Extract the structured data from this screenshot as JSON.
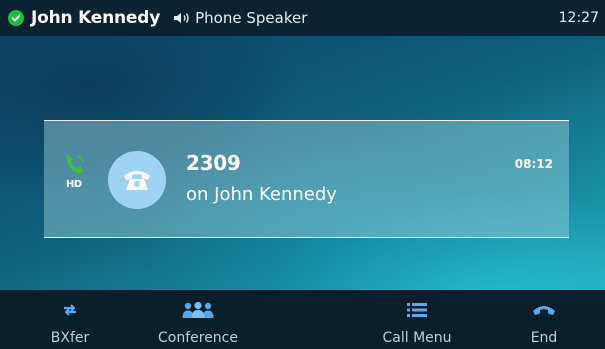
{
  "status_bar": {
    "account_name": "John Kennedy",
    "audio_mode": "Phone Speaker",
    "time": "12:27",
    "status_icon": "registered-check-icon",
    "audio_icon": "speaker-icon"
  },
  "call": {
    "number": "2309",
    "line_label": "on John Kennedy",
    "duration": "08:12",
    "line_icon": "handset-icon",
    "hd_label": "HD",
    "avatar_icon": "phone-avatar-icon"
  },
  "softkeys": [
    {
      "label": "BXfer",
      "icon": "transfer-arrows-icon"
    },
    {
      "label": "Conference",
      "icon": "conference-people-icon"
    },
    {
      "label": "Call Menu",
      "icon": "menu-list-icon"
    },
    {
      "label": "End",
      "icon": "hang-up-icon"
    }
  ],
  "colors": {
    "status_green": "#1fbf3c",
    "line_icon_green": "#3ec13e",
    "icon_blue": "#5aa8e8",
    "avatar_bg": "#9ed4f1"
  }
}
